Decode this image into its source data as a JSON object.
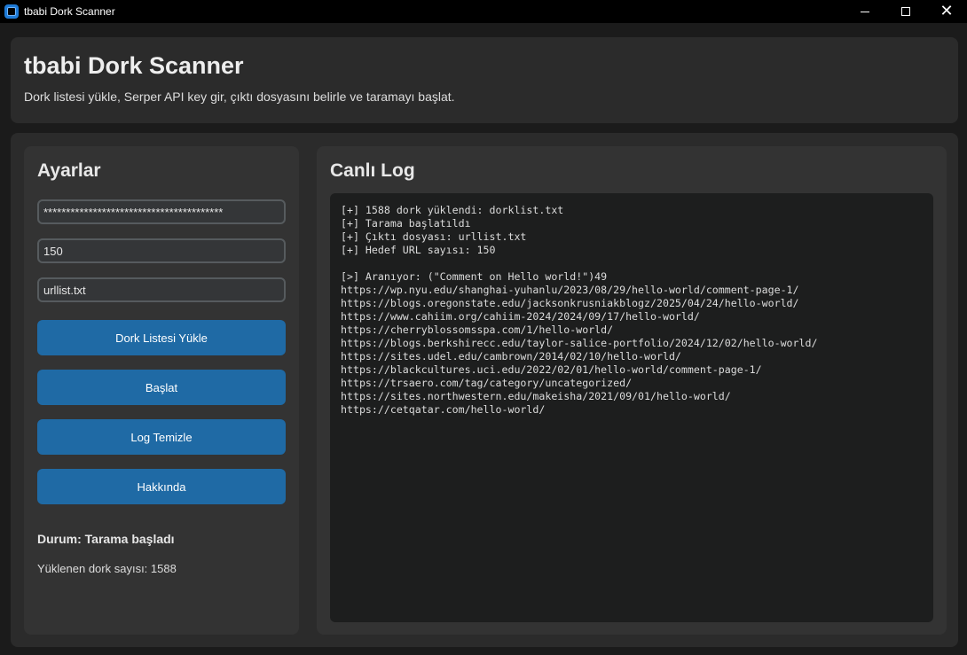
{
  "window": {
    "title": "tbabi Dork Scanner",
    "minimize": "minimize",
    "maximize": "maximize",
    "close": "✕"
  },
  "header": {
    "title": "tbabi Dork Scanner",
    "subtitle": "Dork listesi yükle, Serper API key gir, çıktı dosyasını belirle ve taramayı başlat."
  },
  "settings": {
    "title": "Ayarlar",
    "api_key_value": "****************************************",
    "target_count_value": "150",
    "output_file_value": "urllist.txt",
    "load_button": "Dork Listesi Yükle",
    "start_button": "Başlat",
    "clear_button": "Log Temizle",
    "about_button": "Hakkında",
    "status": "Durum: Tarama başladı",
    "dork_count": "Yüklenen dork sayısı: 1588"
  },
  "log": {
    "title": "Canlı Log",
    "lines": [
      "[+] 1588 dork yüklendi: dorklist.txt",
      "[+] Tarama başlatıldı",
      "[+] Çıktı dosyası: urllist.txt",
      "[+] Hedef URL sayısı: 150",
      "",
      "[>] Aranıyor: (\"Comment on Hello world!\")49",
      "https://wp.nyu.edu/shanghai-yuhanlu/2023/08/29/hello-world/comment-page-1/",
      "https://blogs.oregonstate.edu/jacksonkrusniakblogz/2025/04/24/hello-world/",
      "https://www.cahiim.org/cahiim-2024/2024/09/17/hello-world/",
      "https://cherryblossomsspa.com/1/hello-world/",
      "https://blogs.berkshirecc.edu/taylor-salice-portfolio/2024/12/02/hello-world/",
      "https://sites.udel.edu/cambrown/2014/02/10/hello-world/",
      "https://blackcultures.uci.edu/2022/02/01/hello-world/comment-page-1/",
      "https://trsaero.com/tag/category/uncategorized/",
      "https://sites.northwestern.edu/makeisha/2021/09/01/hello-world/",
      "https://cetqatar.com/hello-world/"
    ]
  }
}
